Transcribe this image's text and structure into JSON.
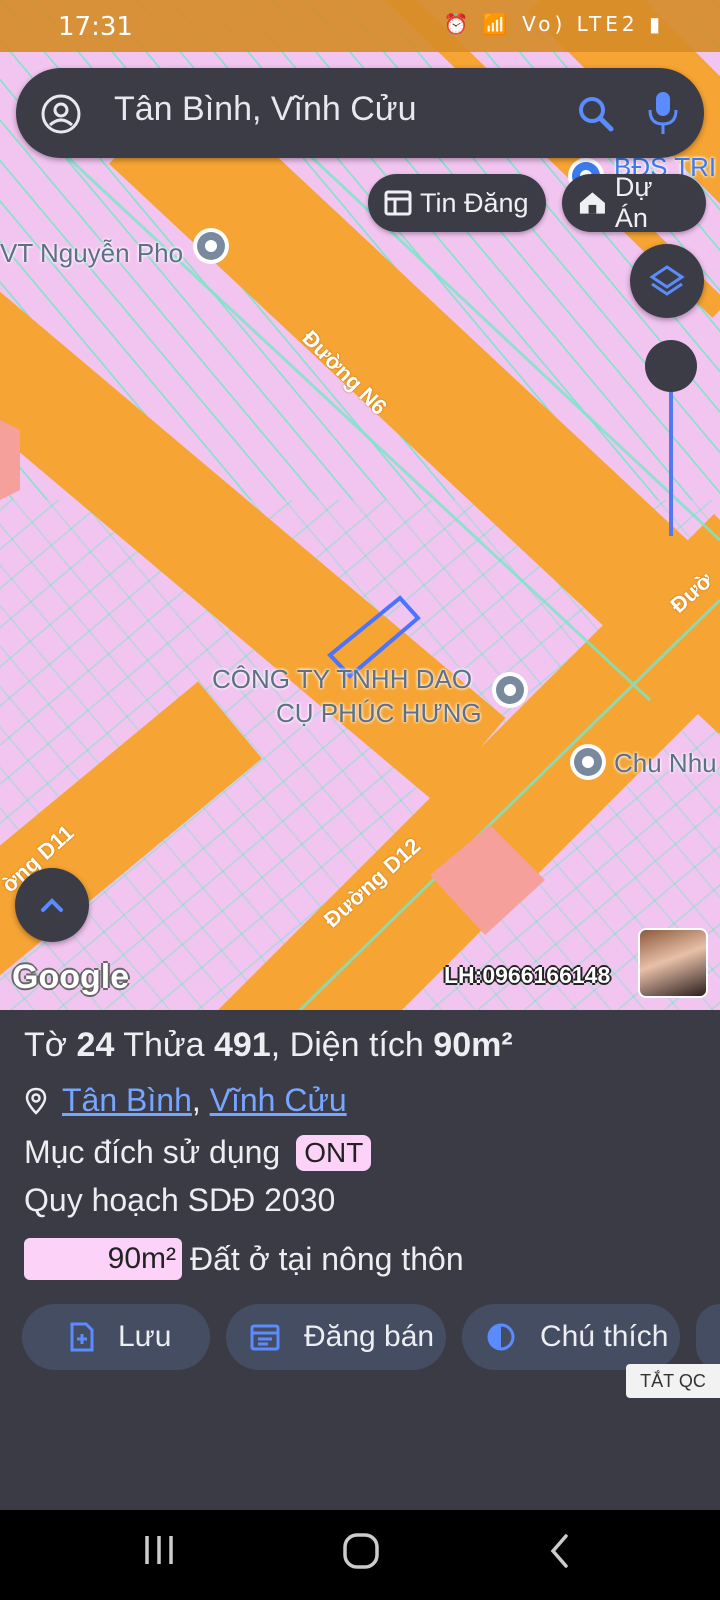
{
  "status_bar": {
    "time": "17:31",
    "indicators": "⏰ 📶 Vo) LTE2 ▮"
  },
  "search": {
    "query": "Tân Bình, Vĩnh Cửu",
    "icons": [
      "account-icon",
      "search-icon",
      "mic-icon"
    ]
  },
  "filter_chips": [
    {
      "label": "Tin Đăng",
      "icon": "listing-icon"
    },
    {
      "label": "Dự Án",
      "icon": "house-icon"
    }
  ],
  "map": {
    "labels": {
      "poi1": "VT Nguyễn Pho",
      "poi2_line1": "CÔNG TY TNHH DAO",
      "poi2_line2": "CỤ PHÚC HƯNG",
      "poi3": "Chu Nhu",
      "poi4": "BĐS TRI"
    },
    "roads": {
      "n6": "Đường N6",
      "d12": "Đường D12",
      "d11": "ờng D11",
      "right": "Đườ"
    },
    "attribution": "Google",
    "contact": "LH:0966166148"
  },
  "parcel": {
    "sheet_label": "Tờ",
    "sheet_no": "24",
    "plot_label": "Thửa",
    "plot_no": "491",
    "area_label": "Diện tích",
    "area": "90m²",
    "ward": "Tân Bình",
    "district": "Vĩnh Cửu",
    "separator": ",",
    "usage_label": "Mục đích sử dụng",
    "usage_code": "ONT",
    "plan_label": "Quy hoạch SDĐ 2030",
    "plan_area": "90m²",
    "plan_use": "Đất ở tại nông thôn"
  },
  "actions": [
    {
      "label": "Lưu",
      "icon": "save-icon"
    },
    {
      "label": "Đăng bán",
      "icon": "calendar-icon"
    },
    {
      "label": "Chú thích",
      "icon": "legend-icon"
    }
  ],
  "ad_toggle": "TẮT QC",
  "colors": {
    "road": "#f6a433",
    "parcel": "#f2c4f0",
    "lot_line": "#78e6c8",
    "accent": "#5b8cff",
    "sheet_bg": "#3a3b44"
  }
}
